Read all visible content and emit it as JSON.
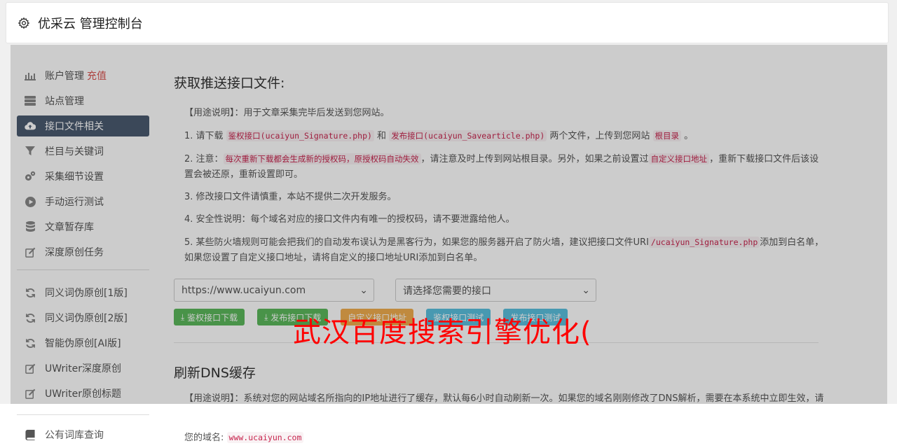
{
  "header": {
    "title": "优采云 管理控制台"
  },
  "sidebar": {
    "items": [
      {
        "label": "账户管理",
        "extra": "充值"
      },
      {
        "label": "站点管理"
      },
      {
        "label": "接口文件相关"
      },
      {
        "label": "栏目与关键词"
      },
      {
        "label": "采集细节设置"
      },
      {
        "label": "手动运行测试"
      },
      {
        "label": "文章暂存库"
      },
      {
        "label": "深度原创任务"
      },
      {
        "label": "同义词伪原创[1版]"
      },
      {
        "label": "同义词伪原创[2版]"
      },
      {
        "label": "智能伪原创[AI版]"
      },
      {
        "label": "UWriter深度原创"
      },
      {
        "label": "UWriter原创标题"
      },
      {
        "label": "公有词库查询"
      }
    ]
  },
  "main": {
    "section1_title": "获取推送接口文件:",
    "usage_label": "【用途说明】",
    "usage_text": "：用于文章采集完毕后发送到您网站。",
    "p1": {
      "a": "1. 请下载 ",
      "code1": "鉴权接口(ucaiyun_Signature.php)",
      "b": " 和 ",
      "code2": "发布接口(ucaiyun_Savearticle.php)",
      "c": " 两个文件，上传到您网站 ",
      "code3": "根目录",
      "d": " 。"
    },
    "p2": {
      "a": "2. 注意：",
      "code1": "每次重新下载都会生成新的授权码，原授权码自动失效",
      "b": "，请注意及时上传到网站根目录。另外，如果之前设置过",
      "code2": "自定义接口地址",
      "c": "，重新下载接口文件后该设置会被还原，重新设置即可。"
    },
    "p3": "3. 修改接口文件请慎重，本站不提供二次开发服务。",
    "p4": "4. 安全性说明：每个域名对应的接口文件内有唯一的授权码，请不要泄露给他人。",
    "p5": {
      "a": "5. 某些防火墙规则可能会把我们的自动发布误认为是黑客行为，如果您的服务器开启了防火墙，建议把接口文件URI",
      "code1": "/ucaiyun_Signature.php",
      "b": "添加到白名单，如果您设置了自定义接口地址，请将自定义的接口地址URI添加到白名单。"
    },
    "site_select": "https://www.ucaiyun.com",
    "api_select": "请选择您需要的接口",
    "buttons": [
      "鉴权接口下载",
      "发布接口下载",
      "自定义接口地址",
      "鉴权接口测试",
      "发布接口测试"
    ],
    "section2_title": "刷新DNS缓存",
    "dns_usage_label": "【用途说明】",
    "dns_usage_text": "：系统对您的网站域名所指向的IP地址进行了缓存，默认每6小时自动刷新一次。如果您的域名刚刚修改了DNS解析，需要在本系统中立即生效，请使用这里的刷新功能。",
    "domain_label": "您的域名:",
    "domain_value": "www.ucaiyun.com"
  },
  "watermark": "武汉百度搜索引擎优化(",
  "colors": {
    "active_sidebar": "#4a5a70",
    "green_btn": "#5cb85c",
    "orange_btn": "#f0ad4e",
    "blue_btn": "#5bc0de",
    "watermark": "#ff0000"
  }
}
